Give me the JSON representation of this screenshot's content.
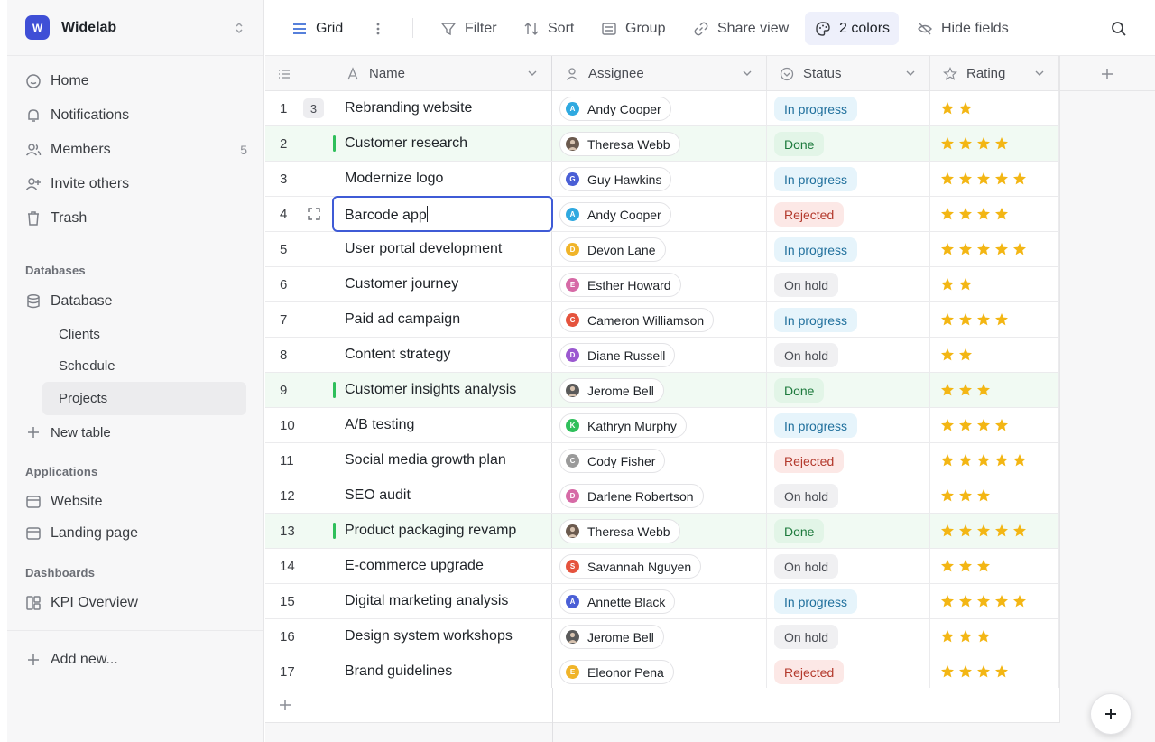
{
  "workspace": {
    "initial": "W",
    "name": "Widelab"
  },
  "nav": [
    {
      "label": "Home",
      "icon": "home-icon"
    },
    {
      "label": "Notifications",
      "icon": "bell-icon"
    },
    {
      "label": "Members",
      "icon": "members-icon",
      "count": "5"
    },
    {
      "label": "Invite others",
      "icon": "invite-icon"
    },
    {
      "label": "Trash",
      "icon": "trash-icon"
    }
  ],
  "databases": {
    "section": "Databases",
    "db_label": "Database",
    "items": [
      "Clients",
      "Schedule",
      "Projects"
    ],
    "active": "Projects",
    "new_table": "New table"
  },
  "applications": {
    "section": "Applications",
    "items": [
      "Website",
      "Landing page"
    ]
  },
  "dashboards": {
    "section": "Dashboards",
    "items": [
      "KPI Overview"
    ]
  },
  "add_new": "Add new...",
  "toolbar": {
    "view": "Grid",
    "filter": "Filter",
    "sort": "Sort",
    "group": "Group",
    "share": "Share view",
    "colors": "2 colors",
    "hide": "Hide fields"
  },
  "columns": {
    "name": "Name",
    "assignee": "Assignee",
    "status": "Status",
    "rating": "Rating"
  },
  "status_colors": {
    "In progress": {
      "bg": "#e6f4fb",
      "fg": "#1f6f9c"
    },
    "Done": {
      "bg": "#e2f5e7",
      "fg": "#1d7a3d"
    },
    "Rejected": {
      "bg": "#fce8e6",
      "fg": "#b3392c"
    },
    "On hold": {
      "bg": "#f0f0f2",
      "fg": "#4a4d54"
    }
  },
  "rows": [
    {
      "n": "1",
      "name": "Rebranding website",
      "assignee": "Andy Cooper",
      "initial": "A",
      "av": "#2fa9e0",
      "status": "In progress",
      "rating": 2,
      "comments": "3"
    },
    {
      "n": "2",
      "name": "Customer research",
      "assignee": "Theresa Webb",
      "initial": "",
      "av": "#6b5a4e",
      "status": "Done",
      "rating": 4
    },
    {
      "n": "3",
      "name": "Modernize logo",
      "assignee": "Guy Hawkins",
      "initial": "G",
      "av": "#4a5fd6",
      "status": "In progress",
      "rating": 5
    },
    {
      "n": "4",
      "name": "Barcode app",
      "assignee": "Andy Cooper",
      "initial": "A",
      "av": "#2fa9e0",
      "status": "Rejected",
      "rating": 4,
      "editing": true
    },
    {
      "n": "5",
      "name": "User portal development",
      "assignee": "Devon Lane",
      "initial": "D",
      "av": "#f0b429",
      "status": "In progress",
      "rating": 5
    },
    {
      "n": "6",
      "name": "Customer journey",
      "assignee": "Esther Howard",
      "initial": "E",
      "av": "#d66aa6",
      "status": "On hold",
      "rating": 2
    },
    {
      "n": "7",
      "name": "Paid ad campaign",
      "assignee": "Cameron Williamson",
      "initial": "C",
      "av": "#e5533d",
      "status": "In progress",
      "rating": 4
    },
    {
      "n": "8",
      "name": "Content strategy",
      "assignee": "Diane Russell",
      "initial": "D",
      "av": "#9b59d0",
      "status": "On hold",
      "rating": 2
    },
    {
      "n": "9",
      "name": "Customer insights analysis",
      "assignee": "Jerome Bell",
      "initial": "",
      "av": "#5a5a5a",
      "status": "Done",
      "rating": 3
    },
    {
      "n": "10",
      "name": "A/B testing",
      "assignee": "Kathryn Murphy",
      "initial": "K",
      "av": "#2fbf5b",
      "status": "In progress",
      "rating": 4
    },
    {
      "n": "11",
      "name": "Social media growth plan",
      "assignee": "Cody Fisher",
      "initial": "C",
      "av": "#9a9a9a",
      "status": "Rejected",
      "rating": 5
    },
    {
      "n": "12",
      "name": "SEO audit",
      "assignee": "Darlene Robertson",
      "initial": "D",
      "av": "#d66aa6",
      "status": "On hold",
      "rating": 3
    },
    {
      "n": "13",
      "name": "Product packaging revamp",
      "assignee": "Theresa Webb",
      "initial": "",
      "av": "#6b5a4e",
      "status": "Done",
      "rating": 5
    },
    {
      "n": "14",
      "name": "E-commerce upgrade",
      "assignee": "Savannah Nguyen",
      "initial": "S",
      "av": "#e5533d",
      "status": "On hold",
      "rating": 3
    },
    {
      "n": "15",
      "name": "Digital marketing analysis",
      "assignee": "Annette Black",
      "initial": "A",
      "av": "#4a5fd6",
      "status": "In progress",
      "rating": 5
    },
    {
      "n": "16",
      "name": "Design system workshops",
      "assignee": "Jerome Bell",
      "initial": "",
      "av": "#5a5a5a",
      "status": "On hold",
      "rating": 3
    },
    {
      "n": "17",
      "name": "Brand guidelines",
      "assignee": "Eleonor Pena",
      "initial": "E",
      "av": "#f0b429",
      "status": "Rejected",
      "rating": 4
    }
  ]
}
